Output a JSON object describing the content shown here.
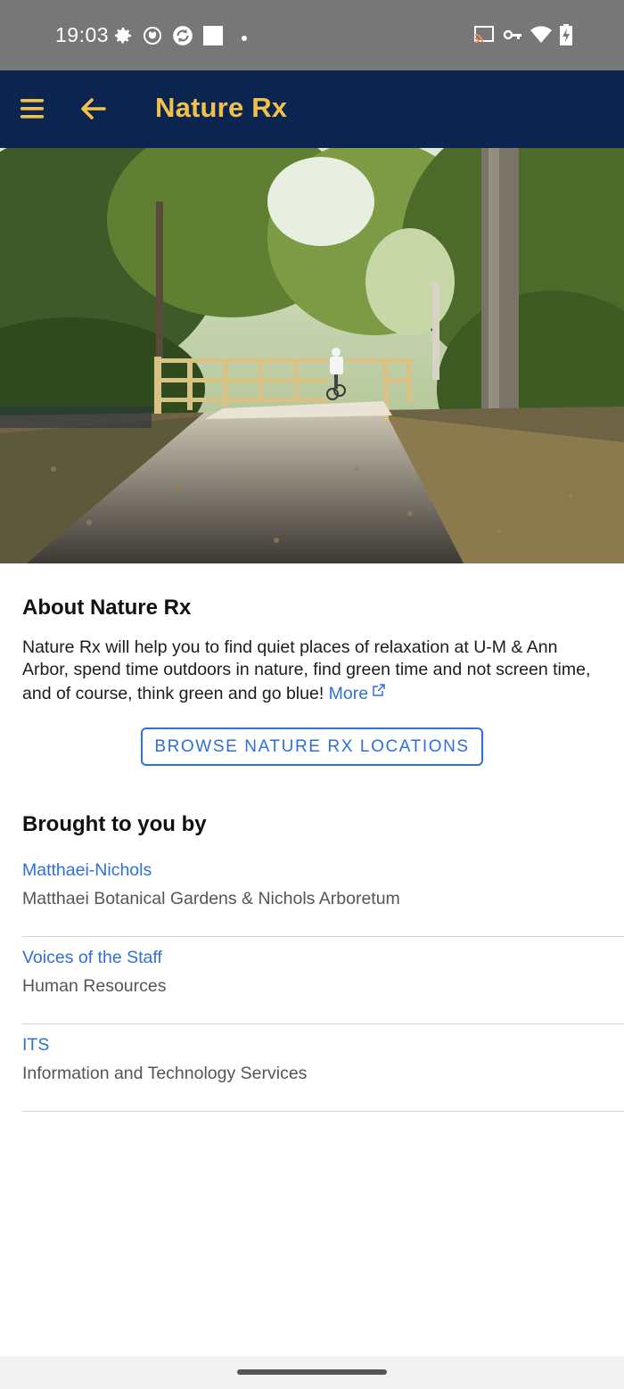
{
  "status_bar": {
    "time": "19:03",
    "left_icons": [
      "settings-icon",
      "github-icon",
      "sync-icon",
      "square-icon",
      "dot-icon"
    ],
    "right_icons": [
      "cast-icon",
      "vpn-key-icon",
      "wifi-icon",
      "battery-charging-icon"
    ]
  },
  "app_bar": {
    "title": "Nature Rx",
    "title_color": "#f2c14b",
    "background": "#0b2550"
  },
  "hero": {
    "image_description_icon": "trail-bridge-photo"
  },
  "about": {
    "heading": "About Nature Rx",
    "text": "Nature Rx will help you to find quiet places of relaxation at U-M & Ann Arbor, spend time outdoors in nature, find green time and not screen time, and of course, think green and go blue!",
    "more_label": "More"
  },
  "browse_button_label": "BROWSE NATURE RX LOCATIONS",
  "brought_by": {
    "heading": "Brought to you by",
    "sponsors": [
      {
        "name": "Matthaei-Nichols",
        "description": "Matthaei Botanical Gardens & Nichols Arboretum"
      },
      {
        "name": "Voices of the Staff",
        "description": "Human Resources"
      },
      {
        "name": "ITS",
        "description": "Information and Technology Services"
      }
    ]
  },
  "accent_color": "#2f6fdc"
}
